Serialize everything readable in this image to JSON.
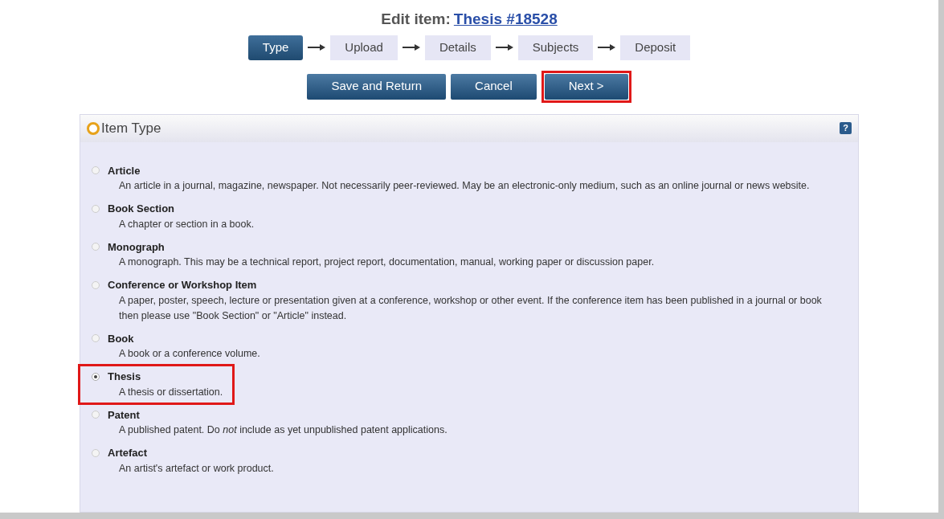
{
  "heading": {
    "label": "Edit item:",
    "link": "Thesis #18528"
  },
  "steps": [
    {
      "label": "Type",
      "selected": true
    },
    {
      "label": "Upload",
      "selected": false
    },
    {
      "label": "Details",
      "selected": false
    },
    {
      "label": "Subjects",
      "selected": false
    },
    {
      "label": "Deposit",
      "selected": false
    }
  ],
  "buttons": [
    {
      "label": "Save and Return",
      "highlighted": false
    },
    {
      "label": "Cancel",
      "highlighted": false
    },
    {
      "label": "Next >",
      "highlighted": true
    }
  ],
  "panel": {
    "title": "Item Type",
    "help_icon": "?"
  },
  "item_types": [
    {
      "name": "Article",
      "description": "An article in a journal, magazine, newspaper. Not necessarily peer-reviewed. May be an electronic-only medium, such as an online journal or news website.",
      "selected": false,
      "highlighted": false
    },
    {
      "name": "Book Section",
      "description": "A chapter or section in a book.",
      "selected": false,
      "highlighted": false
    },
    {
      "name": "Monograph",
      "description": "A monograph. This may be a technical report, project report, documentation, manual, working paper or discussion paper.",
      "selected": false,
      "highlighted": false
    },
    {
      "name": "Conference or Workshop Item",
      "description": "A paper, poster, speech, lecture or presentation given at a conference, workshop or other event. If the conference item has been published in a journal or book then please use \"Book Section\" or \"Article\" instead.",
      "selected": false,
      "highlighted": false
    },
    {
      "name": "Book",
      "description": "A book or a conference volume.",
      "selected": false,
      "highlighted": false
    },
    {
      "name": "Thesis",
      "description": "A thesis or dissertation.",
      "selected": true,
      "highlighted": true
    },
    {
      "name": "Patent",
      "description": "A published patent. Do *not* include as yet unpublished patent applications.",
      "selected": false,
      "highlighted": false
    },
    {
      "name": "Artefact",
      "description": "An artist's artefact or work product.",
      "selected": false,
      "highlighted": false
    }
  ]
}
